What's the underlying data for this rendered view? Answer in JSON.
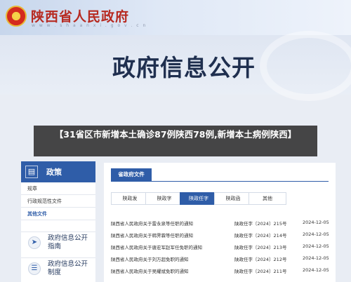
{
  "header": {
    "site_title": "陕西省人民政府",
    "site_url": "w w w . s h a a n x i . g o v . c n"
  },
  "hero": {
    "title": "政府信息公开"
  },
  "sidebar": {
    "head_label": "政策",
    "head_icon": "document-icon",
    "items": [
      {
        "label": "规章"
      },
      {
        "label": "行政规范性文件"
      },
      {
        "label": "其他文件"
      }
    ],
    "cards": [
      {
        "label": "政府信息公开指南",
        "icon": "compass-icon"
      },
      {
        "label": "政府信息公开制度",
        "icon": "list-icon"
      }
    ]
  },
  "main": {
    "panel_title": "省政府文件",
    "chips": [
      "陕政发",
      "陕政字",
      "陕政任字",
      "陕政函",
      "其他"
    ],
    "active_chip_index": 2,
    "rows": [
      {
        "title": "陕西省人民政府关于雷永泉等任职的通知",
        "number": "陕政任字〔2024〕215号",
        "date": "2024-12-05"
      },
      {
        "title": "陕西省人民政府关于韩霁霖等任职的通知",
        "number": "陕政任字〔2024〕214号",
        "date": "2024-12-05"
      },
      {
        "title": "陕西省人民政府关于唐宏军赵军任免职的通知",
        "number": "陕政任字〔2024〕213号",
        "date": "2024-12-05"
      },
      {
        "title": "陕西省人民政府关于刘万超免职的通知",
        "number": "陕政任字〔2024〕212号",
        "date": "2024-12-05"
      },
      {
        "title": "陕西省人民政府关于吴耀斌免职的通知",
        "number": "陕政任字〔2024〕211号",
        "date": "2024-12-05"
      }
    ]
  },
  "banner": {
    "text": "【31省区市新增本土确诊87例陕西78例,新增本土病例陕西】"
  },
  "colors": {
    "brand_blue": "#2f5da8",
    "title_red": "#b72a21"
  }
}
